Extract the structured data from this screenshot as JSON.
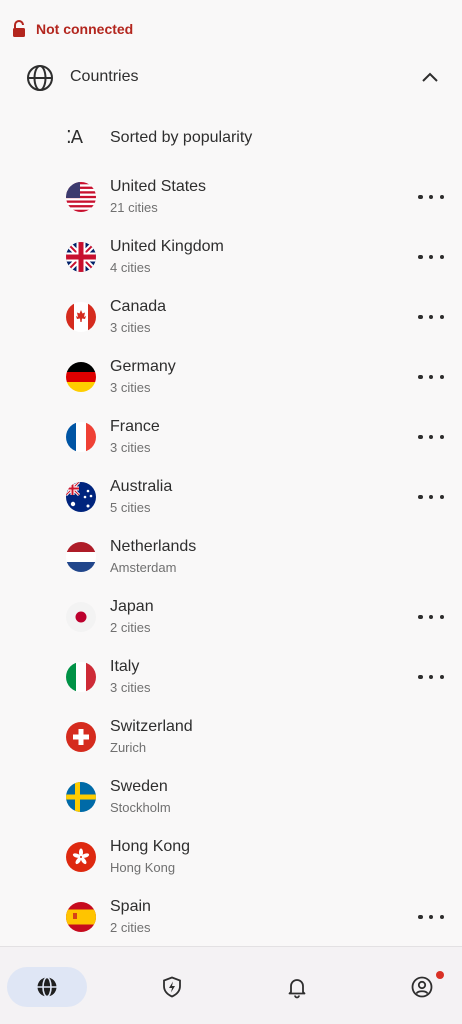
{
  "status": {
    "text": "Not connected",
    "color": "#b3261e",
    "icon": "lock-open-icon"
  },
  "section": {
    "title": "Countries",
    "icon": "globe-icon",
    "toggle_icon": "chevron-up-icon"
  },
  "sort": {
    "label": "Sorted by popularity",
    "icon": "sort-alpha-icon",
    "glyph": "⁚A"
  },
  "countries": [
    {
      "name": "United States",
      "sub": "21 cities",
      "flag": "us-flag-icon",
      "has_more": true
    },
    {
      "name": "United Kingdom",
      "sub": "4 cities",
      "flag": "uk-flag-icon",
      "has_more": true
    },
    {
      "name": "Canada",
      "sub": "3 cities",
      "flag": "canada-flag-icon",
      "has_more": true
    },
    {
      "name": "Germany",
      "sub": "3 cities",
      "flag": "germany-flag-icon",
      "has_more": true
    },
    {
      "name": "France",
      "sub": "3 cities",
      "flag": "france-flag-icon",
      "has_more": true
    },
    {
      "name": "Australia",
      "sub": "5 cities",
      "flag": "australia-flag-icon",
      "has_more": true
    },
    {
      "name": "Netherlands",
      "sub": "Amsterdam",
      "flag": "netherlands-flag-icon",
      "has_more": false
    },
    {
      "name": "Japan",
      "sub": "2 cities",
      "flag": "japan-flag-icon",
      "has_more": true
    },
    {
      "name": "Italy",
      "sub": "3 cities",
      "flag": "italy-flag-icon",
      "has_more": true
    },
    {
      "name": "Switzerland",
      "sub": "Zurich",
      "flag": "switzerland-flag-icon",
      "has_more": false
    },
    {
      "name": "Sweden",
      "sub": "Stockholm",
      "flag": "sweden-flag-icon",
      "has_more": false
    },
    {
      "name": "Hong Kong",
      "sub": "Hong Kong",
      "flag": "hongkong-flag-icon",
      "has_more": false
    },
    {
      "name": "Spain",
      "sub": "2 cities",
      "flag": "spain-flag-icon",
      "has_more": true
    }
  ],
  "nav": [
    {
      "name": "nav-countries",
      "icon": "globe-icon",
      "active": true
    },
    {
      "name": "nav-protection",
      "icon": "shield-bolt-icon",
      "active": false
    },
    {
      "name": "nav-notifications",
      "icon": "bell-icon",
      "active": false
    },
    {
      "name": "nav-profile",
      "icon": "profile-icon",
      "active": false,
      "badge": true
    }
  ],
  "colors": {
    "accent_active": "#dfe6f5",
    "badge": "#d93025"
  }
}
